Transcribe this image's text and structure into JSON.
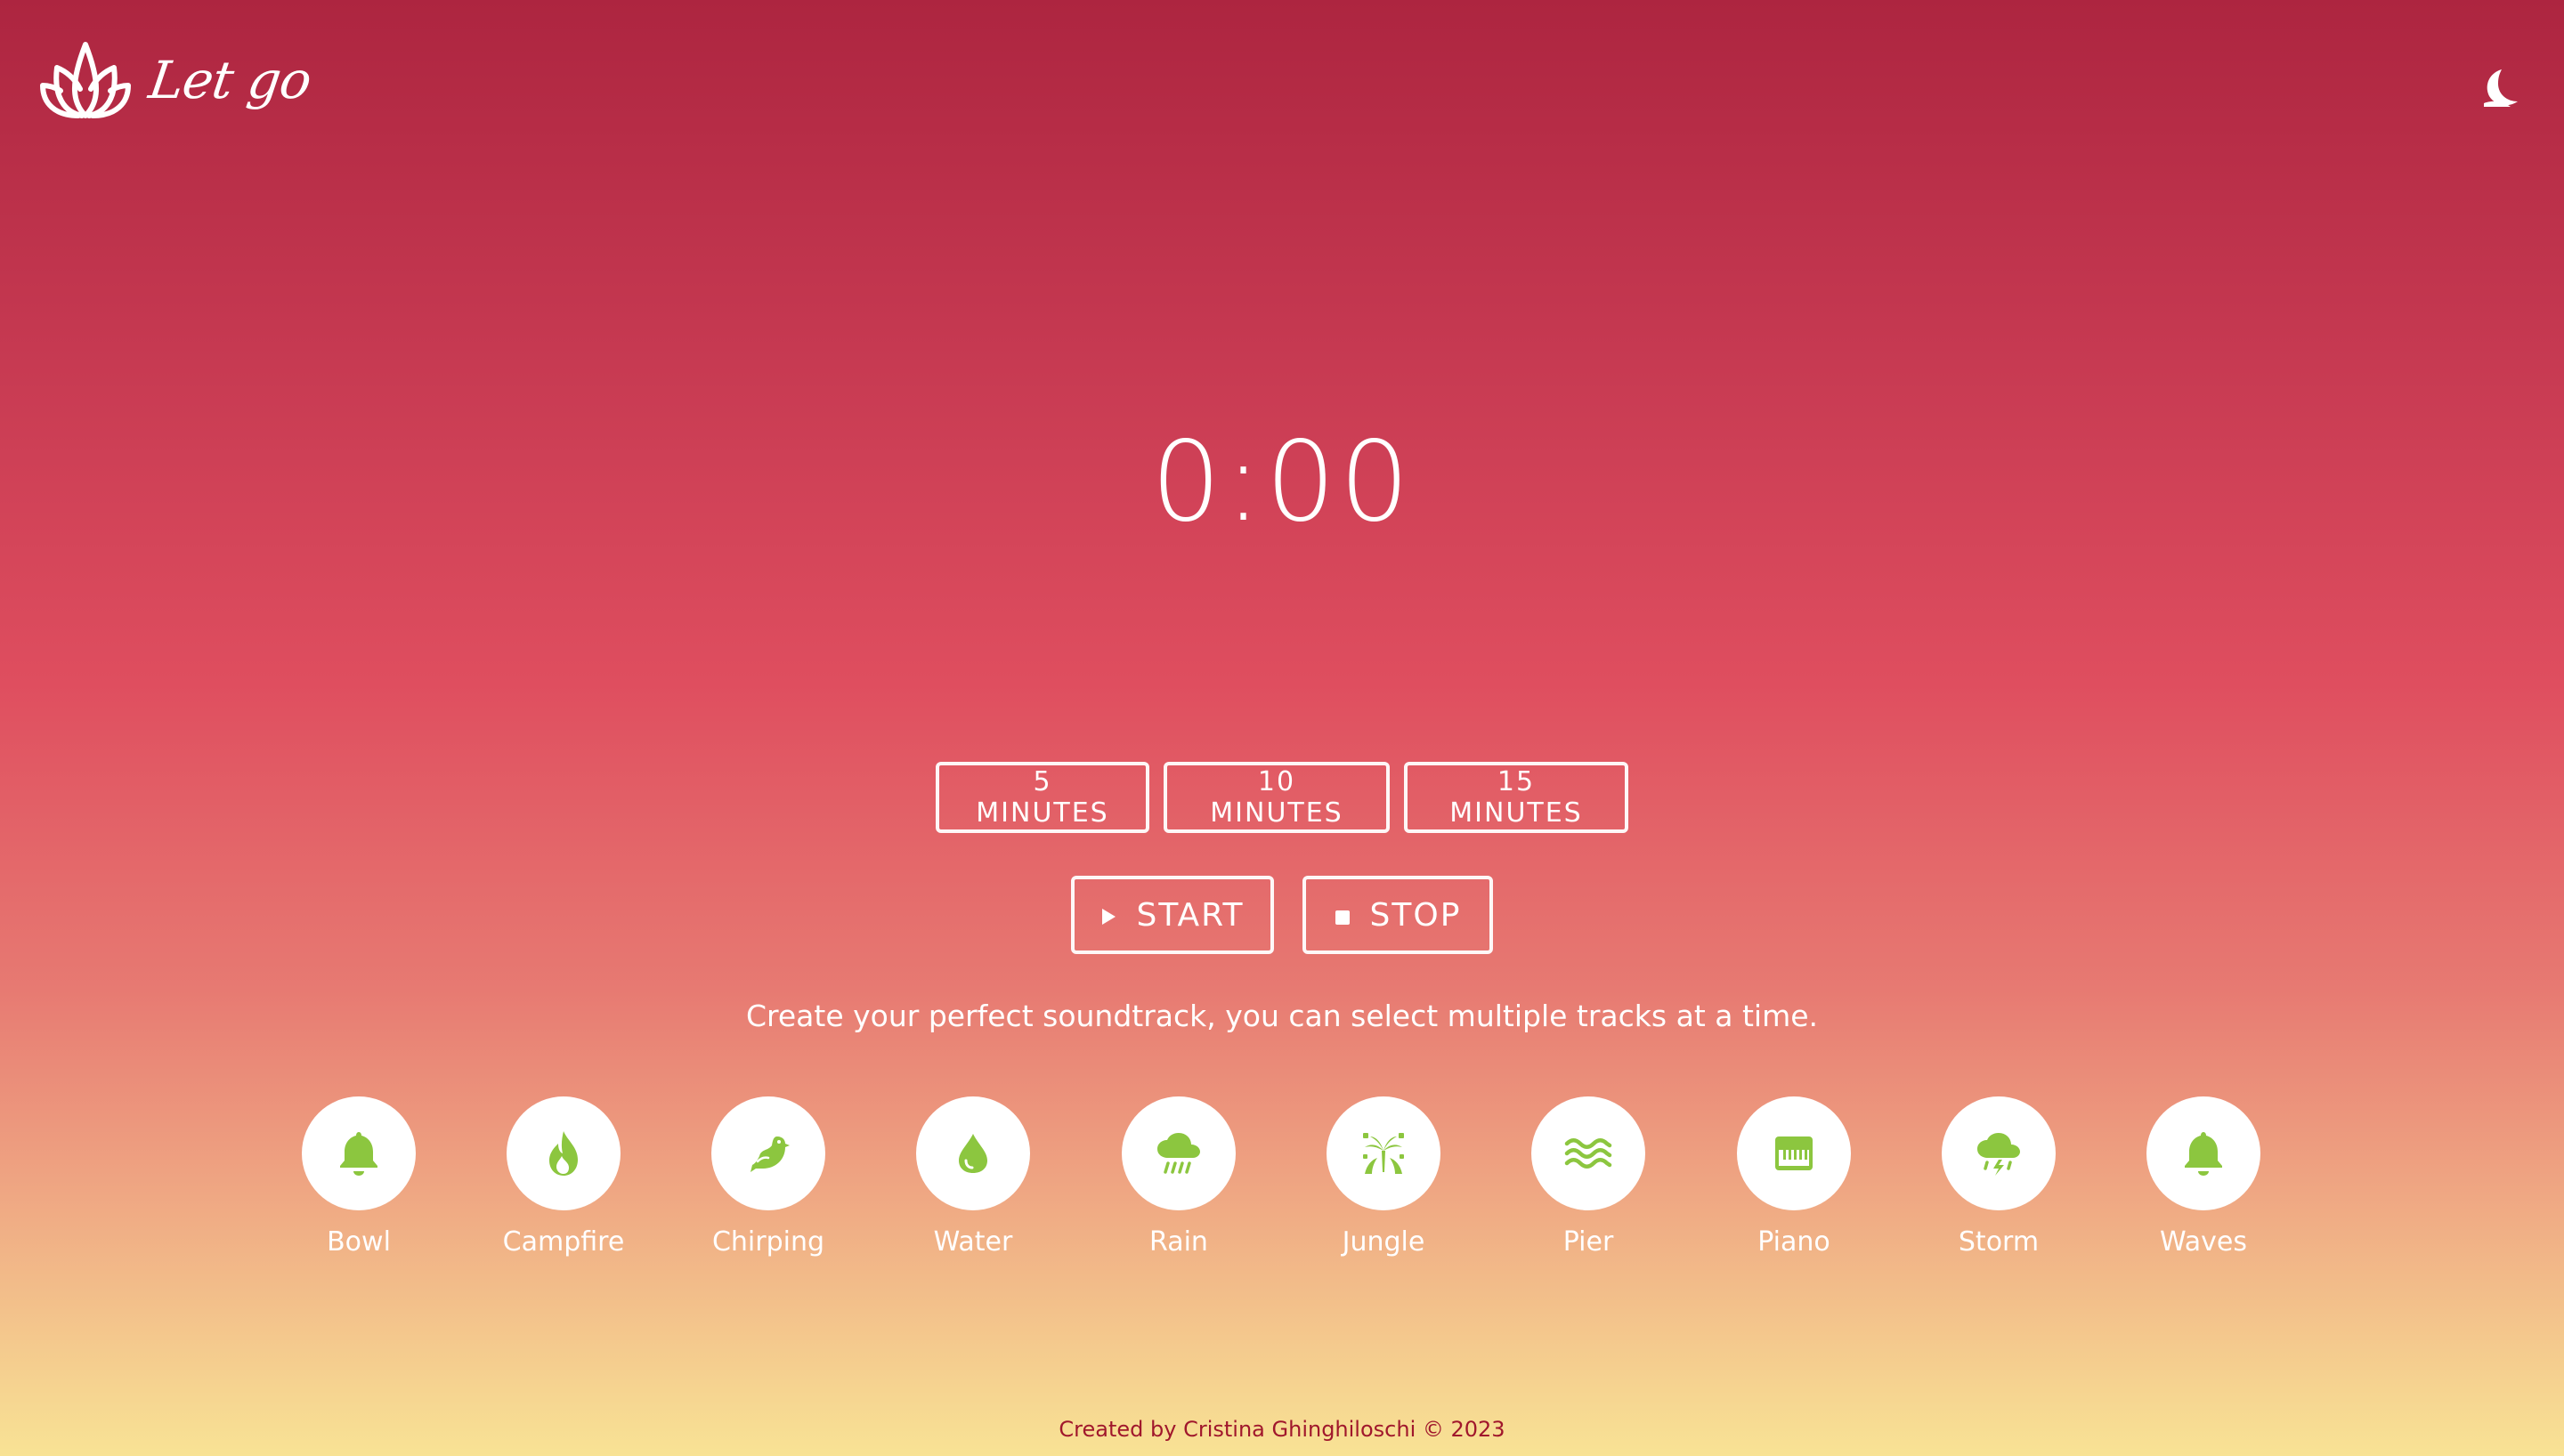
{
  "app": {
    "logo_icon": "lotus-icon",
    "logo_text": "Let go",
    "theme_toggle_icon": "moon-icon"
  },
  "timer": {
    "display": "0:00"
  },
  "durations": [
    {
      "label": "5 MINUTES"
    },
    {
      "label": "10 MINUTES"
    },
    {
      "label": "15 MINUTES"
    }
  ],
  "controls": {
    "start_label": "START",
    "start_icon": "play-icon",
    "stop_label": "STOP",
    "stop_icon": "stop-icon"
  },
  "instructions": "Create your perfect soundtrack, you can select multiple tracks at a time.",
  "tracks": [
    {
      "label": "Bowl",
      "icon": "bell-icon"
    },
    {
      "label": "Campfire",
      "icon": "fire-icon"
    },
    {
      "label": "Chirping",
      "icon": "bird-icon"
    },
    {
      "label": "Water",
      "icon": "droplet-icon"
    },
    {
      "label": "Rain",
      "icon": "cloud-rain-icon"
    },
    {
      "label": "Jungle",
      "icon": "jungle-icon"
    },
    {
      "label": "Pier",
      "icon": "water-waves-icon"
    },
    {
      "label": "Piano",
      "icon": "piano-icon"
    },
    {
      "label": "Storm",
      "icon": "cloud-bolt-icon"
    },
    {
      "label": "Waves",
      "icon": "bell-icon"
    }
  ],
  "footer": "Created by Cristina Ghinghiloschi © 2023",
  "colors": {
    "gradient_top": "#ad2540",
    "gradient_middle": "#df4e5f",
    "gradient_bottom": "#f8e395",
    "icon_green": "#8cc63f",
    "footer_text": "#a0172c"
  }
}
